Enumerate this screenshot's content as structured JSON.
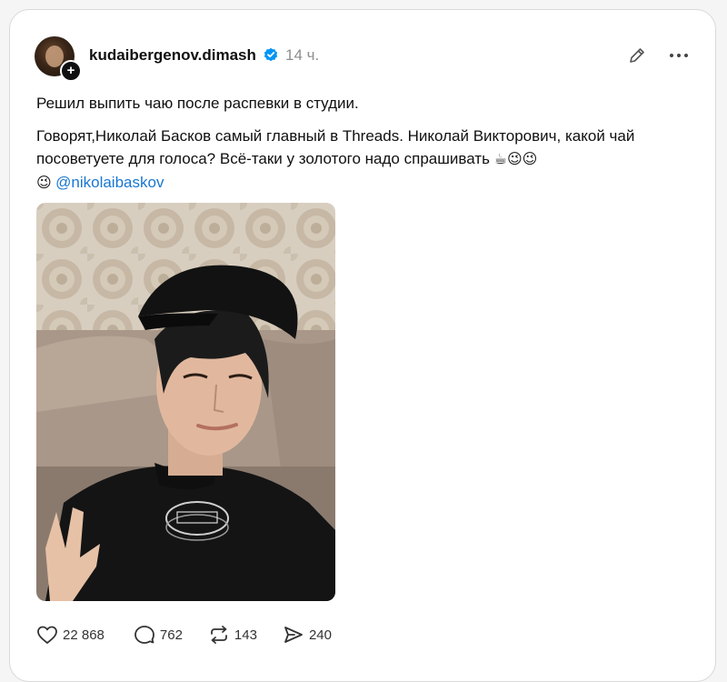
{
  "post": {
    "username": "kudaibergenov.dimash",
    "time": "14 ч.",
    "text_line1": "Решил выпить чаю после распевки в студии.",
    "text_line2_start": "Говорят,Николай Басков самый главный в Threads. Николай Викторович, какой чай посоветуете для голоса? Всё-таки у золотого надо спрашивать ",
    "emojis": "☕😉😉",
    "emoji_lead": "😉 ",
    "mention": "@nikolaibaskov"
  },
  "actions": {
    "likes": "22 868",
    "replies": "762",
    "reposts": "143",
    "shares": "240"
  },
  "icons": {
    "avatar_add": "+",
    "verified": "verified-badge-icon",
    "edit": "pencil-icon",
    "more": "more-horizontal-icon",
    "like": "heart-icon",
    "reply": "speech-bubble-icon",
    "repost": "repost-icon",
    "share": "send-icon"
  },
  "colors": {
    "accent": "#1877d2",
    "verified": "#0095f6",
    "muted": "#8e8e8e"
  }
}
